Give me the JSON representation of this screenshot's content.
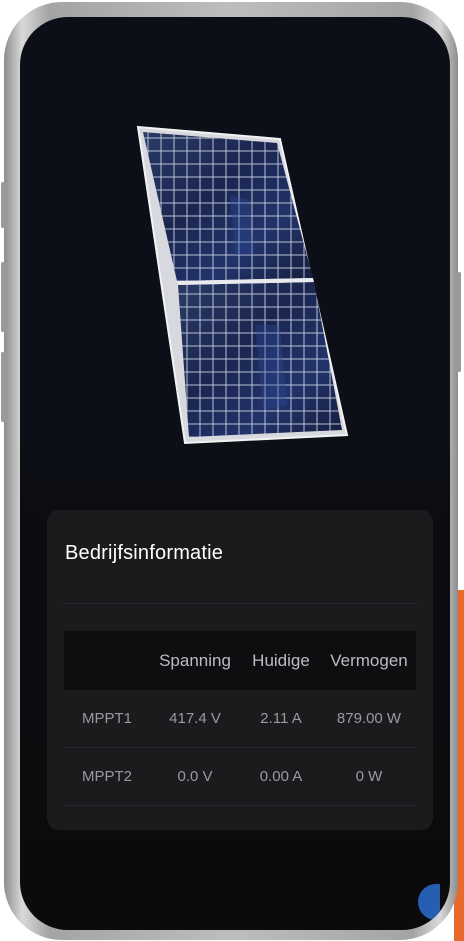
{
  "card": {
    "title": "Bedrijfsinformatie",
    "columns": [
      "",
      "Spanning",
      "Huidige",
      "Vermogen"
    ],
    "rows": [
      {
        "name": "MPPT1",
        "voltage": "417.4 V",
        "current": "2.11 A",
        "power": "879.00 W"
      },
      {
        "name": "MPPT2",
        "voltage": "0.0 V",
        "current": "0.00 A",
        "power": "0 W"
      }
    ]
  },
  "colors": {
    "background": "#0b0b0d",
    "card": "#1b1b1e",
    "accent": "#e8692c"
  },
  "image": {
    "name": "solar-panel"
  }
}
